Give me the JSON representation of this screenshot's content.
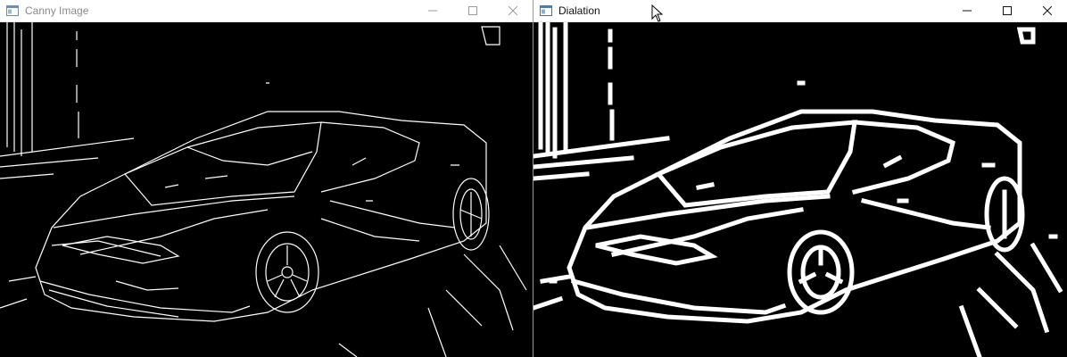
{
  "windows": [
    {
      "title": "Canny Image",
      "image_label": "Canny edge detection of a sports car",
      "controls": [
        "minimize-icon",
        "maximize-icon",
        "close-icon"
      ]
    },
    {
      "title": "Dialation",
      "image_label": "Dilated edge map of the same sports car",
      "controls": [
        "minimize-icon",
        "maximize-icon",
        "close-icon"
      ]
    }
  ],
  "colors": {
    "titlebar_bg": "#ffffff",
    "inactive_title": "#8a8a8a",
    "active_title": "#111111",
    "image_bg": "#000000",
    "edge": "#ffffff"
  }
}
